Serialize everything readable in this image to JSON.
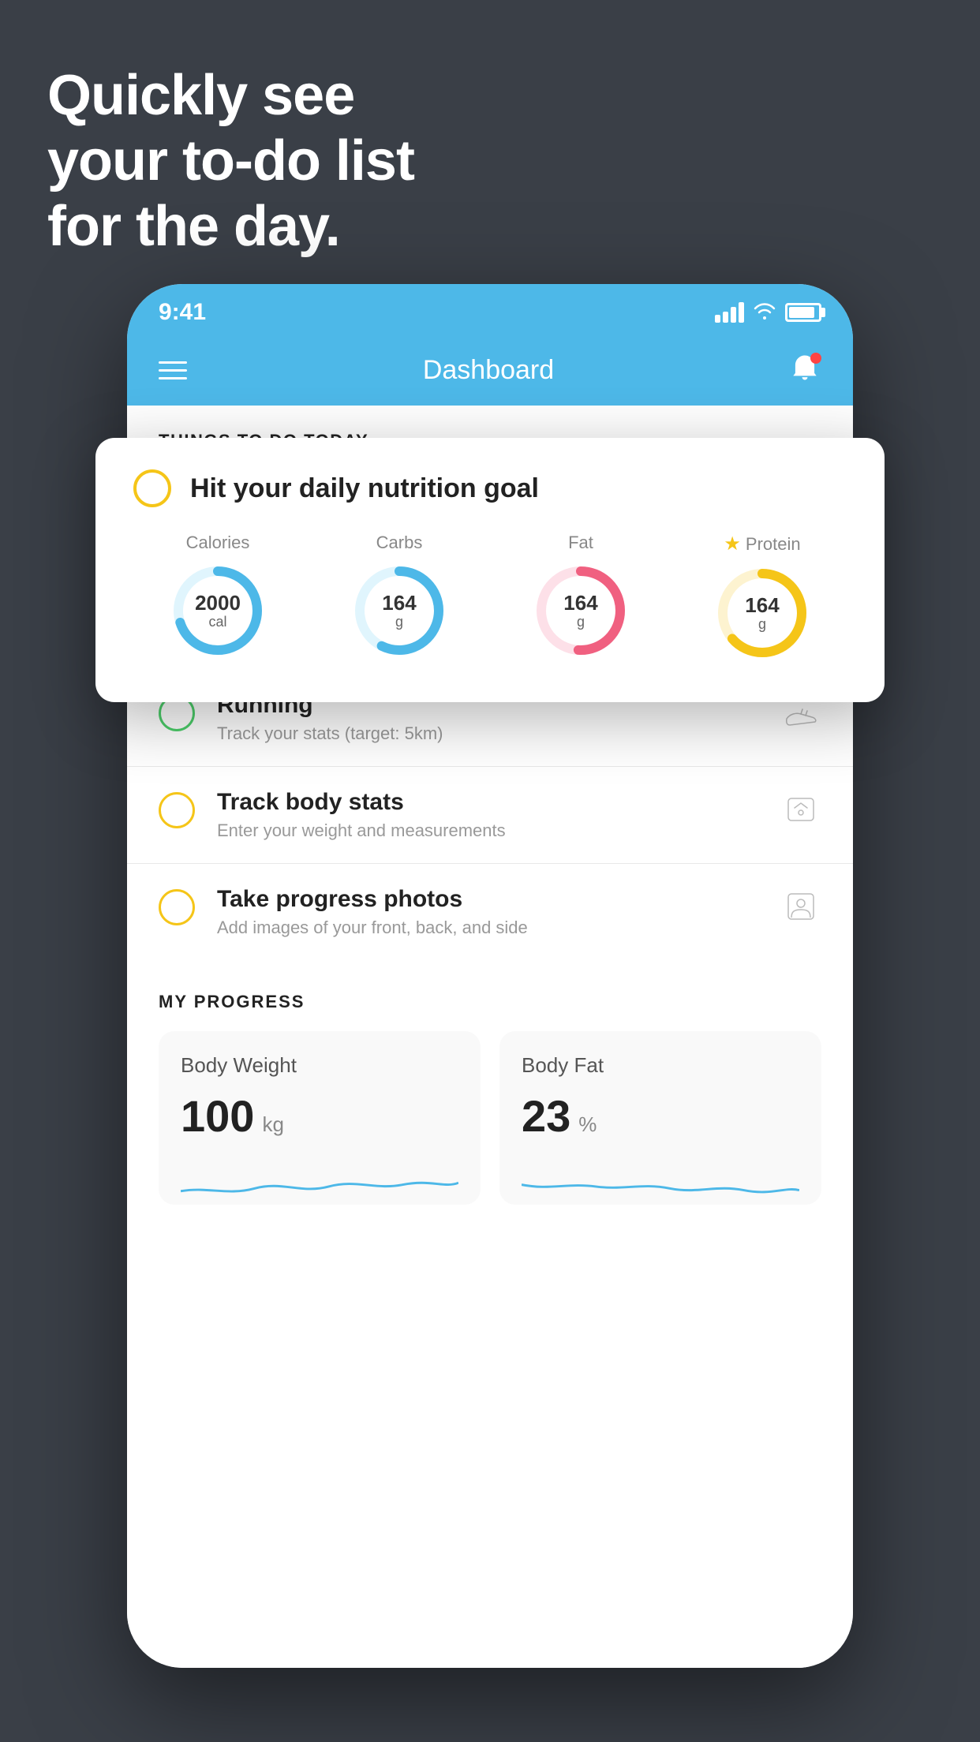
{
  "background_color": "#3a3f47",
  "hero": {
    "line1": "Quickly see",
    "line2": "your to-do list",
    "line3": "for the day."
  },
  "phone": {
    "status_bar": {
      "time": "9:41"
    },
    "nav_bar": {
      "title": "Dashboard"
    },
    "things_section": {
      "header": "THINGS TO DO TODAY"
    },
    "floating_card": {
      "title": "Hit your daily nutrition goal",
      "nutrition": [
        {
          "label": "Calories",
          "value": "2000",
          "unit": "cal",
          "color": "#4db8e8",
          "track_color": "#e0f5fd",
          "circumference": 314,
          "filled": 220
        },
        {
          "label": "Carbs",
          "value": "164",
          "unit": "g",
          "color": "#4db8e8",
          "track_color": "#e0f5fd",
          "circumference": 314,
          "filled": 180
        },
        {
          "label": "Fat",
          "value": "164",
          "unit": "g",
          "color": "#f06080",
          "track_color": "#fde0e8",
          "circumference": 314,
          "filled": 160
        },
        {
          "label": "Protein",
          "value": "164",
          "unit": "g",
          "color": "#f5c518",
          "track_color": "#fdf3d0",
          "circumference": 314,
          "filled": 200,
          "has_star": true
        }
      ]
    },
    "todo_items": [
      {
        "title": "Running",
        "subtitle": "Track your stats (target: 5km)",
        "circle_color": "green",
        "icon_type": "shoe"
      },
      {
        "title": "Track body stats",
        "subtitle": "Enter your weight and measurements",
        "circle_color": "yellow",
        "icon_type": "scale"
      },
      {
        "title": "Take progress photos",
        "subtitle": "Add images of your front, back, and side",
        "circle_color": "yellow",
        "icon_type": "person"
      }
    ],
    "progress_section": {
      "header": "MY PROGRESS",
      "cards": [
        {
          "title": "Body Weight",
          "value": "100",
          "unit": "kg"
        },
        {
          "title": "Body Fat",
          "value": "23",
          "unit": "%"
        }
      ]
    }
  }
}
